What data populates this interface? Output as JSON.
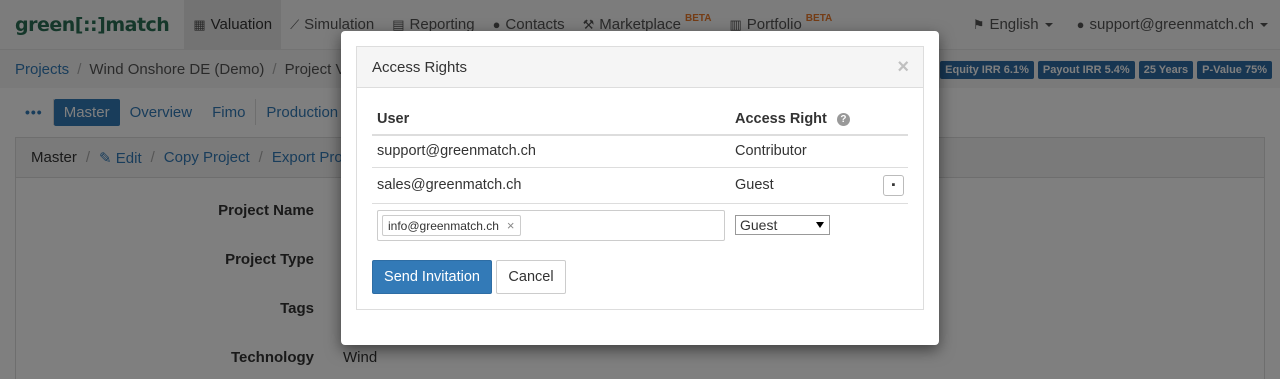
{
  "brand": "green[::]match",
  "nav": [
    {
      "label": "Valuation",
      "icon": "grid-icon",
      "glyph": "▦",
      "beta": ""
    },
    {
      "label": "Simulation",
      "icon": "line-chart-icon",
      "glyph": "⟋",
      "beta": ""
    },
    {
      "label": "Reporting",
      "icon": "document-icon",
      "glyph": "▤",
      "beta": ""
    },
    {
      "label": "Contacts",
      "icon": "users-icon",
      "glyph": "●",
      "beta": ""
    },
    {
      "label": "Marketplace",
      "icon": "gavel-icon",
      "glyph": "⚒",
      "beta": "BETA"
    },
    {
      "label": "Portfolio",
      "icon": "bar-chart-icon",
      "glyph": "▥",
      "beta": "BETA"
    }
  ],
  "nav_right": {
    "language": "English",
    "user": "support@greenmatch.ch"
  },
  "breadcrumb": {
    "projects": "Projects",
    "project": "Wind Onshore DE (Demo)",
    "version": "Project Ve"
  },
  "kpis": [
    "Equity IRR 6.1%",
    "Payout IRR 5.4%",
    "25 Years",
    "P-Value 75%"
  ],
  "tabs": {
    "more": "•••",
    "master": "Master",
    "overview": "Overview",
    "fimo": "Fimo",
    "production": "Production"
  },
  "panel": {
    "title": "Master",
    "edit": "Edit",
    "copy": "Copy Project",
    "export": "Export Proj"
  },
  "fields": [
    {
      "label": "Project Name",
      "value": ""
    },
    {
      "label": "Project Type",
      "value": ""
    },
    {
      "label": "Tags",
      "value": ""
    },
    {
      "label": "Technology",
      "value": "Wind"
    }
  ],
  "modal": {
    "title": "Access Rights",
    "close": "×",
    "col_user": "User",
    "col_right": "Access Right",
    "help": "?",
    "rows": [
      {
        "user": "support@greenmatch.ch",
        "right": "Contributor"
      },
      {
        "user": "sales@greenmatch.ch",
        "right": "Guest"
      }
    ],
    "invite_tag": "info@greenmatch.ch",
    "invite_tag_remove": "×",
    "invite_right": "Guest",
    "send_label": "Send Invitation",
    "cancel_label": "Cancel",
    "trash_glyph": "🗑"
  }
}
